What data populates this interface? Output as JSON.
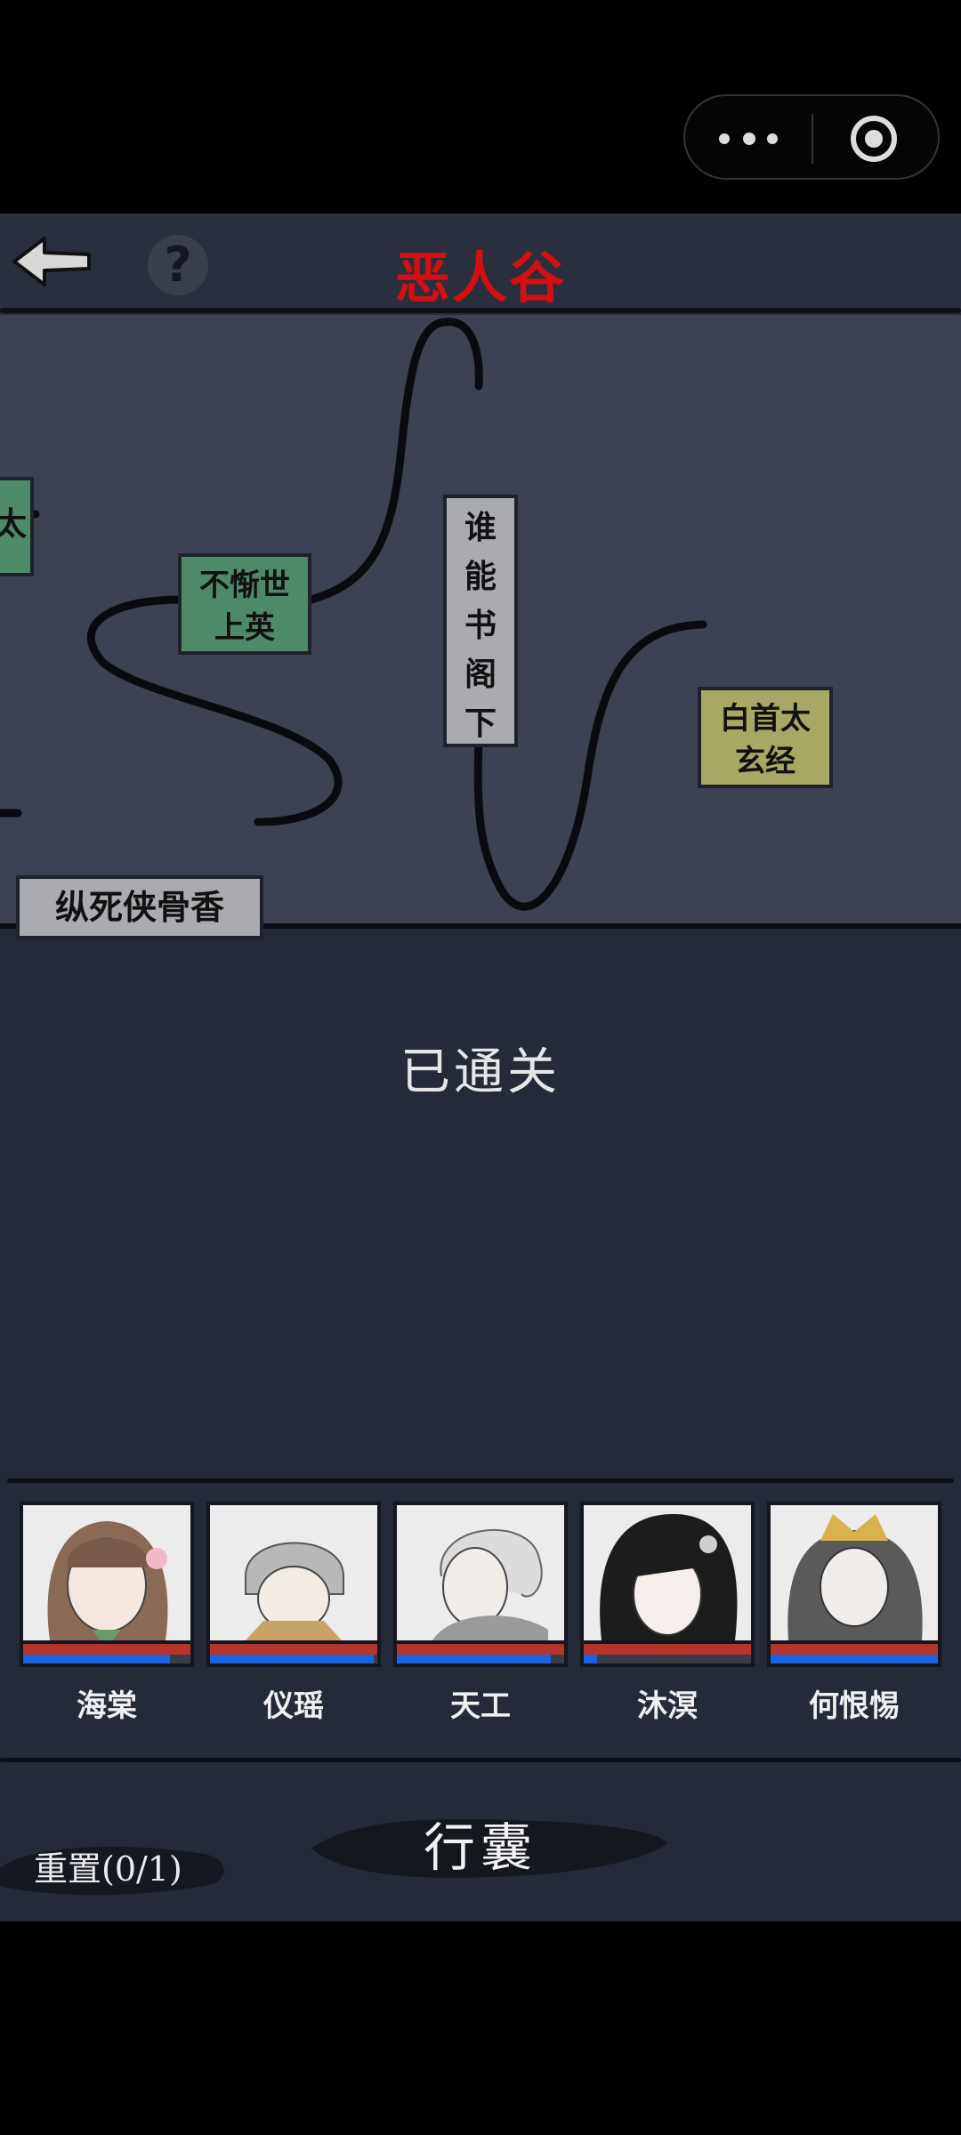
{
  "header": {
    "title": "恶人谷",
    "help_label": "?"
  },
  "map": {
    "nodes": {
      "left": "太",
      "buduan": [
        "不惭世",
        "上英"
      ],
      "zongsi": "纵死侠骨香",
      "shuineng": [
        "谁",
        "能",
        "书",
        "阁",
        "下"
      ],
      "baishou": [
        "白首太",
        "玄经"
      ]
    }
  },
  "status": "已通关",
  "party": [
    {
      "name": "海棠",
      "hp": 1.0,
      "mp": 0.88
    },
    {
      "name": "仪瑶",
      "hp": 1.0,
      "mp": 0.98
    },
    {
      "name": "天工",
      "hp": 1.0,
      "mp": 0.92
    },
    {
      "name": "沐溟",
      "hp": 1.0,
      "mp": 0.08
    },
    {
      "name": "何恨惕",
      "hp": 1.0,
      "mp": 1.0
    }
  ],
  "bottom": {
    "bag": "行囊",
    "reset": "重置(0/1)"
  },
  "colors": {
    "title": "#d40f12",
    "hp": "#b5352d",
    "mp": "#1b63e0",
    "node_gray": "#a9abb0",
    "node_green": "#4e8a6a",
    "node_olive": "#a8a866"
  },
  "icons": [
    "more-dots-icon",
    "close-target-icon",
    "back-arrow-icon",
    "help-icon"
  ]
}
